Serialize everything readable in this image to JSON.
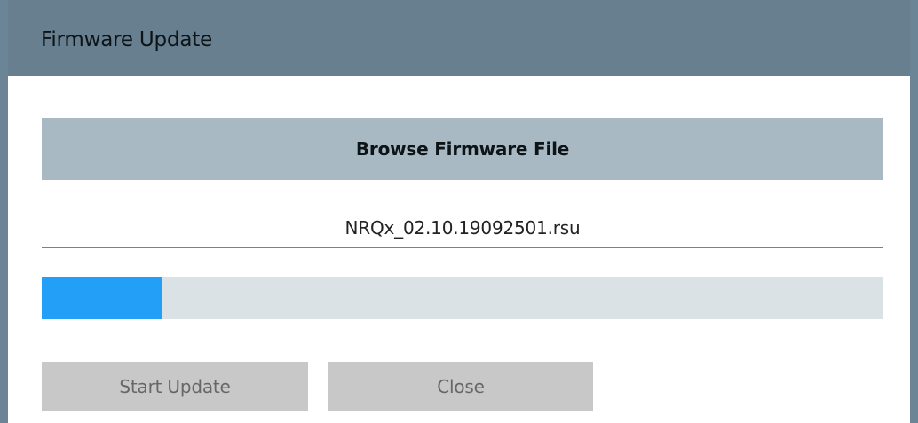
{
  "dialog": {
    "title": "Firmware Update",
    "browse_label": "Browse Firmware File",
    "file_name": "NRQx_02.10.19092501.rsu",
    "progress_fraction": 0.143,
    "start_label": "Start Update",
    "close_label": "Close"
  },
  "colors": {
    "title_bar": "#677f8f",
    "browse_button": "#a9b9c4",
    "progress_fill": "#239ff8",
    "progress_track": "#dbe2e5",
    "disabled_button": "#c8c8c8"
  }
}
